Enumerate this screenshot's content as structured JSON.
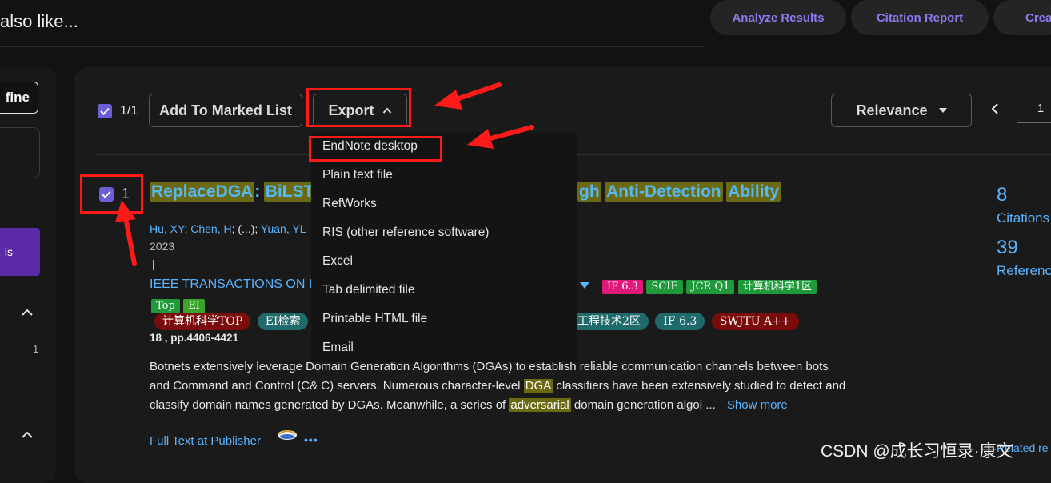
{
  "header": {
    "heading": "also like...",
    "actions": [
      "Analyze Results",
      "Citation Report",
      "Crea"
    ]
  },
  "left_panel": {
    "refine_label": "fine",
    "purple_label": "is",
    "count": "1"
  },
  "toolbar": {
    "selected_count": "1/1",
    "add_to_marked_list": "Add To Marked List",
    "export_label": "Export",
    "sort_label": "Relevance",
    "page_number": "1"
  },
  "export_menu": {
    "items": [
      "EndNote desktop",
      "Plain text file",
      "RefWorks",
      "RIS (other reference software)",
      "Excel",
      "Tab delimited file",
      "Printable HTML file",
      "Email"
    ]
  },
  "result": {
    "index": "1",
    "title_parts": [
      "ReplaceDGA",
      ":",
      "BiLSTM",
      "gh",
      "Anti-Detection",
      "Ability"
    ],
    "authors": [
      "Hu, XY",
      "Chen, H",
      "(...)",
      "Yuan, YL"
    ],
    "year": "2023",
    "separator": "|",
    "journal": "IEEE TRANSACTIONS ON I",
    "badges_row1": [
      {
        "text": "IF 6.3",
        "color": "#e0187a"
      },
      {
        "text": "SCIE",
        "color": "#1e9a3a"
      },
      {
        "text": "JCR Q1",
        "color": "#1e9a3a"
      },
      {
        "text": "计算机科学1区",
        "color": "#1e9a3a"
      }
    ],
    "badges_row2": [
      {
        "text": "Top",
        "color": "#1e9a3a"
      },
      {
        "text": "EI",
        "color": "#3aa52a"
      }
    ],
    "badges_row3_left": [
      {
        "text": "计算机科学TOP",
        "color": "#7a0c0c"
      },
      {
        "text": "EI检索",
        "color": "#1f6b6b"
      }
    ],
    "badges_row3_right": [
      {
        "text": "工程技术2区",
        "color": "#1f6b6b"
      },
      {
        "text": "IF 6.3",
        "color": "#1f6b6b"
      },
      {
        "text": "SWJTU A++",
        "color": "#7a0c0c"
      }
    ],
    "pages": "18 , pp.4406-4421",
    "abstract": {
      "line1_a": "Botnets extensively leverage ",
      "line1_b": "Domain Generation Algorithms (DGAs) to establish reliable communication channels between bots",
      "line2_a": "and Command and Control (C& C) servers. Numerous character-level ",
      "line2_hl": "DGA",
      "line2_b": " classifiers have been extensively studied to detect and",
      "line3_a": "classify domain names generated by DGAs. Meanwhile, a series of ",
      "line3_hl": "adversarial",
      "line3_b": " domain generation algoi ...",
      "show_more": "Show more"
    },
    "full_text": "Full Text at Publisher",
    "more": "•••",
    "citations_count": "8",
    "citations_label": "Citations",
    "references_count": "39",
    "references_label": "Referenc",
    "related": "Related re"
  },
  "watermark": "CSDN @成长习恒录·康文",
  "annotation_color": "#ff1a1a"
}
